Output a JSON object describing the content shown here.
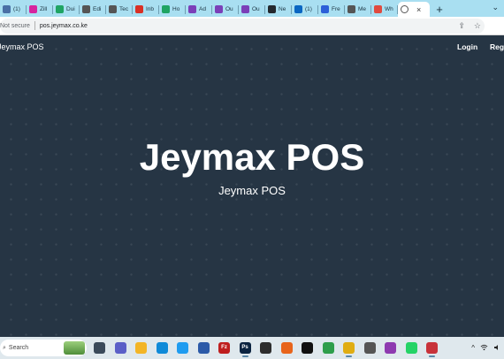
{
  "browser": {
    "tabs": [
      {
        "label": "(1)",
        "icon": "generic-tab-icon",
        "color": "#4a6fa5"
      },
      {
        "label": "Zill",
        "icon": "instagram-icon",
        "color": "#d6249f"
      },
      {
        "label": "Dui",
        "icon": "drive-icon",
        "color": "#1fa463"
      },
      {
        "label": "Edi",
        "icon": "feather-icon",
        "color": "#555555"
      },
      {
        "label": "Tec",
        "icon": "feather-icon",
        "color": "#555555"
      },
      {
        "label": "Inb",
        "icon": "gmail-icon",
        "color": "#d93025"
      },
      {
        "label": "Ho",
        "icon": "drive-icon",
        "color": "#1fa463"
      },
      {
        "label": "Ad",
        "icon": "puzzle-icon",
        "color": "#7b3fb8"
      },
      {
        "label": "Ou",
        "icon": "puzzle-icon",
        "color": "#7b3fb8"
      },
      {
        "label": "Ou",
        "icon": "puzzle-icon",
        "color": "#7b3fb8"
      },
      {
        "label": "Ne",
        "icon": "github-icon",
        "color": "#24292e"
      },
      {
        "label": "(1)",
        "icon": "linkedin-icon",
        "color": "#0a66c2"
      },
      {
        "label": "Fre",
        "icon": "form-icon",
        "color": "#2c5fd8"
      },
      {
        "label": "Me",
        "icon": "feather-icon",
        "color": "#555555"
      },
      {
        "label": "Wh",
        "icon": "link-icon",
        "color": "#e04a3f"
      }
    ],
    "active_tab": {
      "label": "×",
      "icon": "globe-icon"
    },
    "new_tab_label": "+",
    "tab_menu_icon": "chevron-down-icon",
    "security_label": "Not secure",
    "url": "pos.jeymax.co.ke",
    "address_icons": [
      "share-icon",
      "star-icon"
    ]
  },
  "page": {
    "brand": "Jeymax POS",
    "nav": {
      "login": "Login",
      "register": "Register"
    },
    "hero": {
      "title": "Jeymax POS",
      "subtitle": "Jeymax POS"
    },
    "background_color": "#263544"
  },
  "taskbar": {
    "search_placeholder": "Search",
    "apps": [
      {
        "name": "task-view-icon",
        "color": "#3b4a5a"
      },
      {
        "name": "teams-chat-icon",
        "color": "#5b5fc7"
      },
      {
        "name": "file-explorer-icon",
        "color": "#f3b526"
      },
      {
        "name": "edge-icon",
        "color": "#0f8ad8"
      },
      {
        "name": "vscode-icon",
        "color": "#1f9cf0"
      },
      {
        "name": "virtualbox-icon",
        "color": "#2b5aa8"
      },
      {
        "name": "filezilla-icon",
        "color": "#bf1e1e",
        "glyph": "Fz"
      },
      {
        "name": "photoshop-icon",
        "color": "#0b2340",
        "glyph": "Ps",
        "active": true
      },
      {
        "name": "terminal-icon",
        "color": "#2d2d2d"
      },
      {
        "name": "firefox-icon",
        "color": "#e8641b"
      },
      {
        "name": "tiktok-icon",
        "color": "#111111"
      },
      {
        "name": "pencil-app-icon",
        "color": "#2e9e4b"
      },
      {
        "name": "chrome-icon",
        "color": "#e0ad12",
        "active": true
      },
      {
        "name": "sticky-notes-icon",
        "color": "#555555"
      },
      {
        "name": "app-c-icon",
        "color": "#8e3ab0"
      },
      {
        "name": "whatsapp-icon",
        "color": "#25d366"
      },
      {
        "name": "snipping-tool-icon",
        "color": "#c8323a",
        "active": true
      }
    ],
    "tray": {
      "chevron": "^",
      "wifi_icon": "wifi-icon",
      "volume_icon": "volume-icon"
    }
  }
}
